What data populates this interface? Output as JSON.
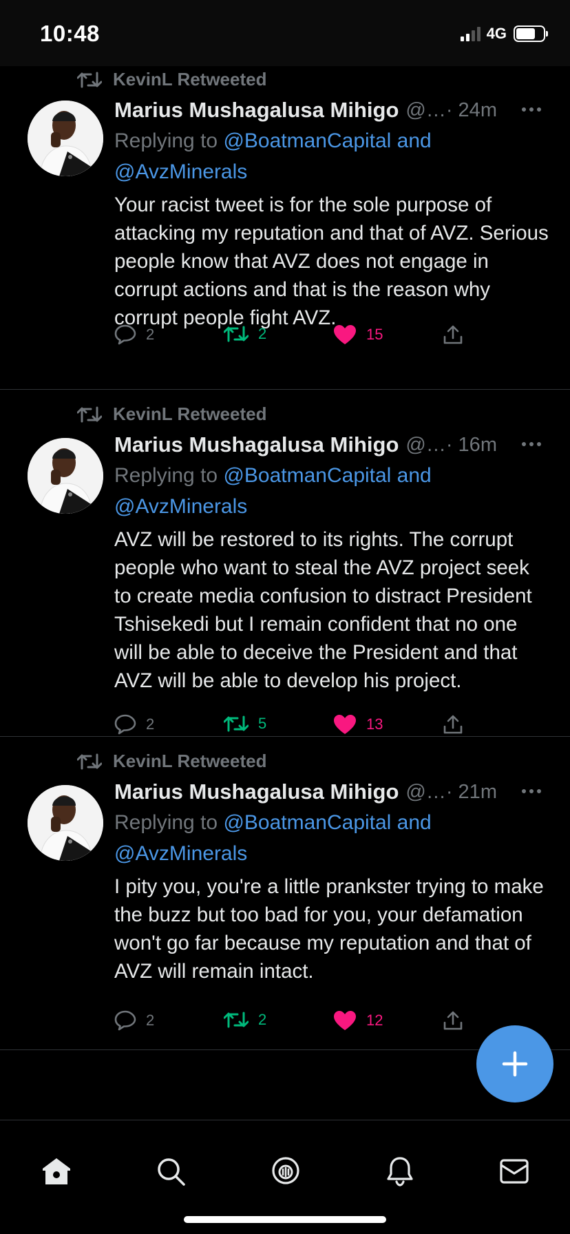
{
  "status_bar": {
    "time": "10:48",
    "network": "4G"
  },
  "tweets": [
    {
      "retweeted_by": "KevinL Retweeted",
      "display_name": "Marius Mushagalusa Mihigo",
      "handle": "@…",
      "time": "· 24m",
      "replying_prefix": "Replying to ",
      "replying_line1": "@BoatmanCapital and",
      "replying_line2": "@AvzMinerals",
      "text": "Your racist tweet is for the sole purpose of attacking my reputation and that of AVZ. Serious people know that AVZ does not engage in corrupt actions and that is the reason why corrupt people fight AVZ.",
      "replies": "2",
      "retweets": "2",
      "likes": "15"
    },
    {
      "retweeted_by": "KevinL Retweeted",
      "display_name": "Marius Mushagalusa Mihigo",
      "handle": "@…",
      "time": "· 16m",
      "replying_prefix": "Replying to ",
      "replying_line1": "@BoatmanCapital and",
      "replying_line2": "@AvzMinerals",
      "text": "AVZ will be restored to its rights. The corrupt people who want to steal the AVZ project seek to create media confusion to distract President Tshisekedi but I remain confident that no one will be able to deceive the President and that AVZ will be able to develop his project.",
      "replies": "2",
      "retweets": "5",
      "likes": "13"
    },
    {
      "retweeted_by": "KevinL Retweeted",
      "display_name": "Marius Mushagalusa Mihigo",
      "handle": "@…",
      "time": "· 21m",
      "replying_prefix": "Replying to ",
      "replying_line1": "@BoatmanCapital and",
      "replying_line2": "@AvzMinerals",
      "text": "I pity you, you're a little prankster trying to make the buzz but too bad for you, your defamation won't go far because my reputation and that of AVZ will remain intact.",
      "replies": "2",
      "retweets": "2",
      "likes": "12"
    }
  ],
  "icons": {
    "retweet": "retweet-icon",
    "reply": "reply-icon",
    "like": "heart-icon",
    "share": "share-icon",
    "compose": "plus-icon",
    "home": "home-icon",
    "search": "search-icon",
    "spaces": "spaces-icon",
    "notifications": "bell-icon",
    "messages": "mail-icon"
  },
  "colors": {
    "accent": "#4b97e6",
    "retweet": "#00ba7c",
    "like": "#f91880",
    "muted": "#71767b"
  }
}
